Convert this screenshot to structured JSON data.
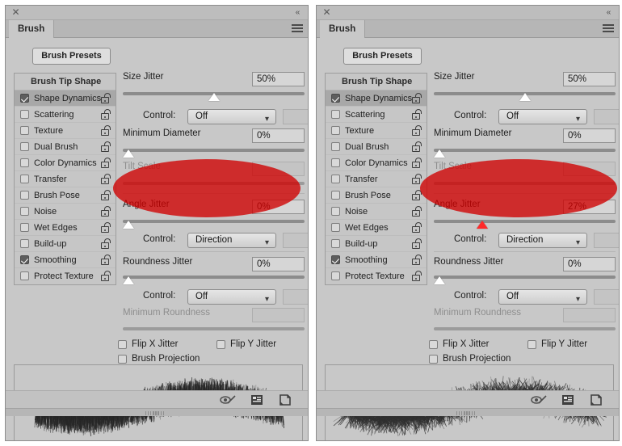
{
  "window": {
    "close_icon": "close-icon",
    "collapse_icon": "collapse-chevrons-icon",
    "menu_icon": "panel-menu-icon"
  },
  "tab": {
    "label": "Brush"
  },
  "presets_button": {
    "label": "Brush Presets"
  },
  "option_list": {
    "header": "Brush Tip Shape",
    "items": [
      {
        "label": "Shape Dynamics",
        "checked": true,
        "selected": true
      },
      {
        "label": "Scattering",
        "checked": false,
        "selected": false
      },
      {
        "label": "Texture",
        "checked": false,
        "selected": false
      },
      {
        "label": "Dual Brush",
        "checked": false,
        "selected": false
      },
      {
        "label": "Color Dynamics",
        "checked": false,
        "selected": false
      },
      {
        "label": "Transfer",
        "checked": false,
        "selected": false
      },
      {
        "label": "Brush Pose",
        "checked": false,
        "selected": false
      },
      {
        "label": "Noise",
        "checked": false,
        "selected": false
      },
      {
        "label": "Wet Edges",
        "checked": false,
        "selected": false
      },
      {
        "label": "Build-up",
        "checked": false,
        "selected": false
      },
      {
        "label": "Smoothing",
        "checked": true,
        "selected": false
      },
      {
        "label": "Protect Texture",
        "checked": false,
        "selected": false
      }
    ]
  },
  "controls": {
    "size_jitter_label": "Size Jitter",
    "size_jitter_value": "50%",
    "size_control_label": "Control:",
    "size_control_value": "Off",
    "minimum_diameter_label": "Minimum Diameter",
    "minimum_diameter_value": "0%",
    "tilt_scale_label": "Tilt Scale",
    "tilt_scale_value": "",
    "angle_jitter_label": "Angle Jitter",
    "angle_control_label": "Control:",
    "angle_control_value": "Direction",
    "roundness_jitter_label": "Roundness Jitter",
    "roundness_jitter_value": "0%",
    "roundness_control_label": "Control:",
    "roundness_control_value": "Off",
    "minimum_roundness_label": "Minimum Roundness",
    "minimum_roundness_value": "",
    "flip_x_label": "Flip X Jitter",
    "flip_y_label": "Flip Y Jitter",
    "brush_projection_label": "Brush Projection",
    "chevron": "⌄"
  },
  "panels": {
    "left": {
      "angle_jitter_value": "0%",
      "angle_jitter_thumb_pct": 0
    },
    "right": {
      "angle_jitter_value": "27%",
      "angle_jitter_thumb_pct": 27
    }
  },
  "bottom_toolbar": {
    "icons": [
      {
        "name": "toggle-brush-preview-icon"
      },
      {
        "name": "brush-presets-panel-icon"
      },
      {
        "name": "create-new-brush-icon"
      }
    ]
  },
  "annotation": {
    "color": "#d00000",
    "shape": "ellipse",
    "target": "angle-jitter-section"
  },
  "colors": {
    "panel_bg": "#c8c8c8",
    "titlebar_bg": "#bdbdbd",
    "selected_row": "#a8a8a8",
    "annotation_red": "#d00000",
    "field_bg": "#d6d6d6"
  }
}
